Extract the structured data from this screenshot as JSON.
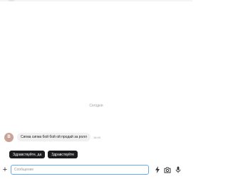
{
  "chat": {
    "date_separator": "Сегодня",
    "messages": [
      {
        "avatar_letter": "В",
        "avatar_color": "#c9a397",
        "text": "Сигма сигма бой бой ой продай за ролл",
        "time": "16:40"
      }
    ]
  },
  "quick_replies": [
    "Здравствуйте, да",
    "Здравствуйте"
  ],
  "composer": {
    "placeholder": "Сообщение",
    "value": "",
    "add_icon": "plus-icon",
    "tools": [
      "lightning-icon",
      "camera-icon",
      "microphone-icon"
    ],
    "accent_color": "#6aa9ee"
  }
}
